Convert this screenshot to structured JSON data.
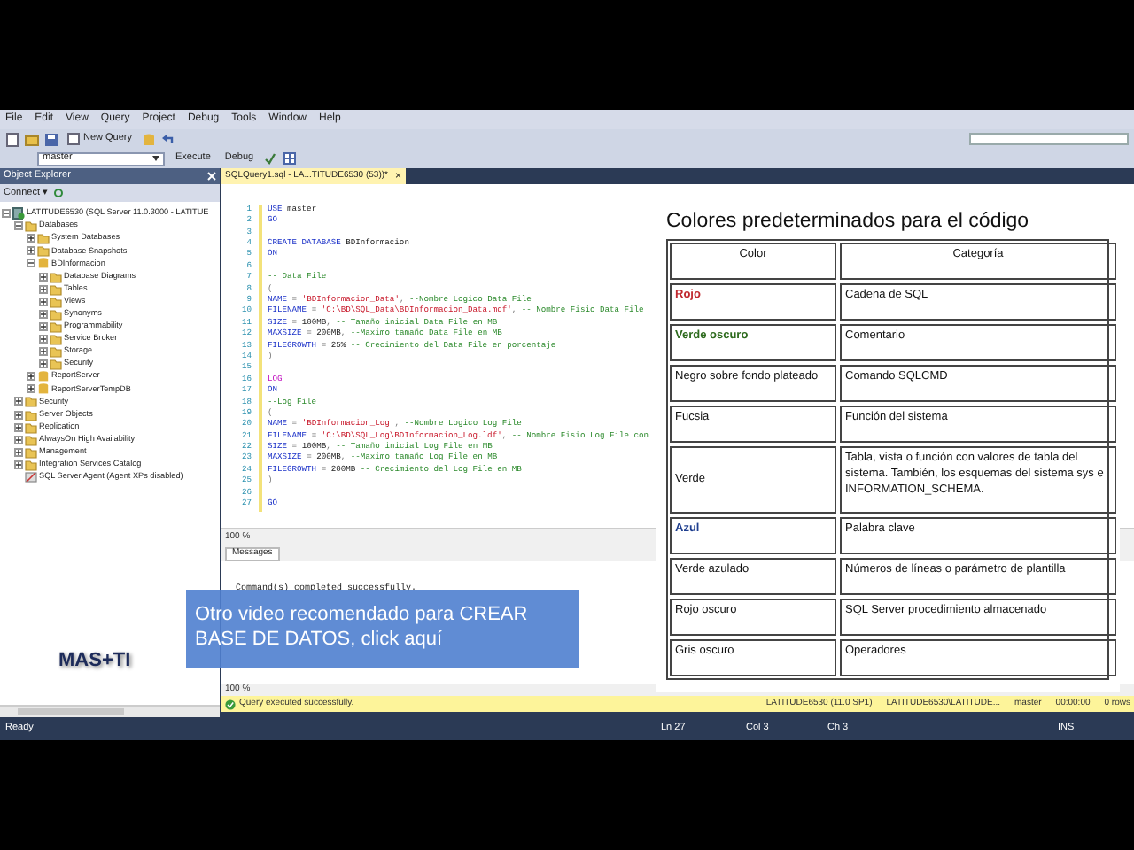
{
  "menu": [
    "File",
    "Edit",
    "View",
    "Query",
    "Project",
    "Debug",
    "Tools",
    "Window",
    "Help"
  ],
  "toolbar": {
    "new_query": "New Query",
    "database": "master",
    "execute": "Execute",
    "debug": "Debug"
  },
  "object_explorer": {
    "title": "Object Explorer",
    "connect": "Connect ▾",
    "tree": [
      {
        "label": "LATITUDE6530 (SQL Server 11.0.3000 - LATITUE",
        "kind": "server",
        "expanded": true,
        "children": [
          {
            "label": "Databases",
            "kind": "folder",
            "expanded": true,
            "children": [
              {
                "label": "System Databases",
                "kind": "folder",
                "expanded": false
              },
              {
                "label": "Database Snapshots",
                "kind": "folder",
                "expanded": false
              },
              {
                "label": "BDInformacion",
                "kind": "database",
                "expanded": true,
                "children": [
                  {
                    "label": "Database Diagrams",
                    "kind": "folder",
                    "expanded": false
                  },
                  {
                    "label": "Tables",
                    "kind": "folder",
                    "expanded": false
                  },
                  {
                    "label": "Views",
                    "kind": "folder",
                    "expanded": false
                  },
                  {
                    "label": "Synonyms",
                    "kind": "folder",
                    "expanded": false
                  },
                  {
                    "label": "Programmability",
                    "kind": "folder",
                    "expanded": false
                  },
                  {
                    "label": "Service Broker",
                    "kind": "folder",
                    "expanded": false
                  },
                  {
                    "label": "Storage",
                    "kind": "folder",
                    "expanded": false
                  },
                  {
                    "label": "Security",
                    "kind": "folder",
                    "expanded": false
                  }
                ]
              },
              {
                "label": "ReportServer",
                "kind": "database",
                "expanded": false
              },
              {
                "label": "ReportServerTempDB",
                "kind": "database",
                "expanded": false
              }
            ]
          },
          {
            "label": "Security",
            "kind": "folder",
            "expanded": false
          },
          {
            "label": "Server Objects",
            "kind": "folder",
            "expanded": false
          },
          {
            "label": "Replication",
            "kind": "folder",
            "expanded": false
          },
          {
            "label": "AlwaysOn High Availability",
            "kind": "folder",
            "expanded": false
          },
          {
            "label": "Management",
            "kind": "folder",
            "expanded": false
          },
          {
            "label": "Integration Services Catalog",
            "kind": "folder",
            "expanded": false
          },
          {
            "label": "SQL Server Agent (Agent XPs disabled)",
            "kind": "agent"
          }
        ]
      }
    ]
  },
  "editor": {
    "tab": "SQLQuery1.sql - LA...TITUDE6530 (53))*",
    "close": "×",
    "lines": [
      {
        "number": "1",
        "tokens": [
          {
            "text": "USE ",
            "kind": "keyword"
          },
          {
            "text": "master",
            "kind": "plain"
          }
        ]
      },
      {
        "number": "2",
        "tokens": [
          {
            "text": "GO",
            "kind": "keyword"
          }
        ]
      },
      {
        "number": "3"
      },
      {
        "number": "4",
        "tokens": [
          {
            "text": "CREATE DATABASE ",
            "kind": "keyword"
          },
          {
            "text": "BDInformacion",
            "kind": "plain"
          }
        ]
      },
      {
        "number": "5",
        "tokens": [
          {
            "text": "ON",
            "kind": "keyword"
          }
        ]
      },
      {
        "number": "6"
      },
      {
        "number": "7",
        "tokens": [
          {
            "text": "-- Data File",
            "kind": "comment"
          }
        ]
      },
      {
        "number": "8",
        "tokens": [
          {
            "text": "(",
            "kind": "operator"
          }
        ]
      },
      {
        "number": "9",
        "tokens": [
          {
            "text": "NAME ",
            "kind": "keyword"
          },
          {
            "text": "= ",
            "kind": "operator"
          },
          {
            "text": "'BDInformacion_Data'",
            "kind": "string"
          },
          {
            "text": ", ",
            "kind": "operator"
          },
          {
            "text": "--Nombre Logico Data File",
            "kind": "comment"
          }
        ]
      },
      {
        "number": "10",
        "tokens": [
          {
            "text": "FILENAME ",
            "kind": "keyword"
          },
          {
            "text": "= ",
            "kind": "operator"
          },
          {
            "text": "'C:\\BD\\SQL_Data\\BDInformacion_Data.mdf'",
            "kind": "string"
          },
          {
            "text": ", ",
            "kind": "operator"
          },
          {
            "text": "-- Nombre Fisio Data File",
            "kind": "comment"
          }
        ]
      },
      {
        "number": "11",
        "tokens": [
          {
            "text": "SIZE ",
            "kind": "keyword"
          },
          {
            "text": "= ",
            "kind": "operator"
          },
          {
            "text": "100MB",
            "kind": "plain"
          },
          {
            "text": ", ",
            "kind": "operator"
          },
          {
            "text": "-- Tamaño inicial Data File en MB",
            "kind": "comment"
          }
        ]
      },
      {
        "number": "12",
        "tokens": [
          {
            "text": "MAXSIZE ",
            "kind": "keyword"
          },
          {
            "text": "= ",
            "kind": "operator"
          },
          {
            "text": "200MB",
            "kind": "plain"
          },
          {
            "text": ", ",
            "kind": "operator"
          },
          {
            "text": "--Maximo tamaño Data File en MB",
            "kind": "comment"
          }
        ]
      },
      {
        "number": "13",
        "tokens": [
          {
            "text": "FILEGROWTH ",
            "kind": "keyword"
          },
          {
            "text": "= ",
            "kind": "operator"
          },
          {
            "text": "25% ",
            "kind": "plain"
          },
          {
            "text": "-- Crecimiento del Data File en porcentaje",
            "kind": "comment"
          }
        ]
      },
      {
        "number": "14",
        "tokens": [
          {
            "text": ")",
            "kind": "operator"
          }
        ]
      },
      {
        "number": "15"
      },
      {
        "number": "16",
        "tokens": [
          {
            "text": "LOG",
            "kind": "function"
          }
        ]
      },
      {
        "number": "17",
        "tokens": [
          {
            "text": "ON",
            "kind": "keyword"
          }
        ]
      },
      {
        "number": "18",
        "tokens": [
          {
            "text": "--Log File",
            "kind": "comment"
          }
        ]
      },
      {
        "number": "19",
        "tokens": [
          {
            "text": "(",
            "kind": "operator"
          }
        ]
      },
      {
        "number": "20",
        "tokens": [
          {
            "text": "NAME ",
            "kind": "keyword"
          },
          {
            "text": "= ",
            "kind": "operator"
          },
          {
            "text": "'BDInformacion_Log'",
            "kind": "string"
          },
          {
            "text": ", ",
            "kind": "operator"
          },
          {
            "text": "--Nombre Logico Log File",
            "kind": "comment"
          }
        ]
      },
      {
        "number": "21",
        "tokens": [
          {
            "text": "FILENAME ",
            "kind": "keyword"
          },
          {
            "text": "= ",
            "kind": "operator"
          },
          {
            "text": "'C:\\BD\\SQL_Log\\BDInformacion_Log.ldf'",
            "kind": "string"
          },
          {
            "text": ", ",
            "kind": "operator"
          },
          {
            "text": "-- Nombre Fisio Log File con",
            "kind": "comment"
          }
        ]
      },
      {
        "number": "22",
        "tokens": [
          {
            "text": "SIZE ",
            "kind": "keyword"
          },
          {
            "text": "= ",
            "kind": "operator"
          },
          {
            "text": "100MB",
            "kind": "plain"
          },
          {
            "text": ", ",
            "kind": "operator"
          },
          {
            "text": "-- Tamaño inicial Log File en MB",
            "kind": "comment"
          }
        ]
      },
      {
        "number": "23",
        "tokens": [
          {
            "text": "MAXSIZE ",
            "kind": "keyword"
          },
          {
            "text": "= ",
            "kind": "operator"
          },
          {
            "text": "200MB",
            "kind": "plain"
          },
          {
            "text": ", ",
            "kind": "operator"
          },
          {
            "text": "--Maximo tamaño Log File en MB",
            "kind": "comment"
          }
        ]
      },
      {
        "number": "24",
        "tokens": [
          {
            "text": "FILEGROWTH ",
            "kind": "keyword"
          },
          {
            "text": "= ",
            "kind": "operator"
          },
          {
            "text": "200MB ",
            "kind": "plain"
          },
          {
            "text": "-- Crecimiento del Log File en MB",
            "kind": "comment"
          }
        ]
      },
      {
        "number": "25",
        "tokens": [
          {
            "text": ")",
            "kind": "operator"
          }
        ]
      },
      {
        "number": "26"
      },
      {
        "number": "27",
        "tokens": [
          {
            "text": "GO",
            "kind": "keyword"
          }
        ]
      }
    ],
    "zoom": "100 %",
    "messages_tab": "Messages",
    "message": "Command(s) completed successfully.",
    "zoom_2": "100 %"
  },
  "query_status": {
    "message": "Query executed successfully.",
    "server": "LATITUDE6530 (11.0 SP1)",
    "login": "LATITUDE6530\\LATITUDE...",
    "database": "master",
    "time": "00:00:00",
    "rows": "0 rows"
  },
  "status_bar": {
    "ready": "Ready",
    "line": "Ln 27",
    "col": "Col 3",
    "ch": "Ch 3",
    "mode": "INS"
  },
  "color_table": {
    "title": "Colores predeterminados para el código",
    "columns": [
      "Color",
      "Categoría"
    ],
    "rows": [
      {
        "color_name": "Rojo",
        "category": "Cadena de SQL",
        "color": "#c0282e",
        "bold": true
      },
      {
        "color_name": "Verde oscuro",
        "category": "Comentario",
        "color": "#2e6b1e",
        "bold": true
      },
      {
        "color_name": "Negro sobre fondo plateado",
        "category": "Comando SQLCMD",
        "color": "#111111",
        "bold": false
      },
      {
        "color_name": "Fucsia",
        "category": "Función del sistema",
        "color": "#111111",
        "bold": false
      },
      {
        "color_name": "Verde",
        "category": "Tabla, vista o función con valores de tabla del sistema. También, los esquemas del sistema sys e INFORMATION_SCHEMA.",
        "color": "#111111",
        "bold": false
      },
      {
        "color_name": "Azul",
        "category": "Palabra clave",
        "color": "#1f3f8f",
        "bold": true
      },
      {
        "color_name": "Verde azulado",
        "category": "Números de líneas o parámetro de plantilla",
        "color": "#111111",
        "bold": false
      },
      {
        "color_name": "Rojo oscuro",
        "category": "SQL Server procedimiento almacenado",
        "color": "#111111",
        "bold": false
      },
      {
        "color_name": "Gris oscuro",
        "category": "Operadores",
        "color": "#111111",
        "bold": false
      }
    ]
  },
  "video_overlay": {
    "text": "Otro video recomendado para CREAR BASE DE DATOS, click aquí"
  },
  "logo": "MAS+TI"
}
